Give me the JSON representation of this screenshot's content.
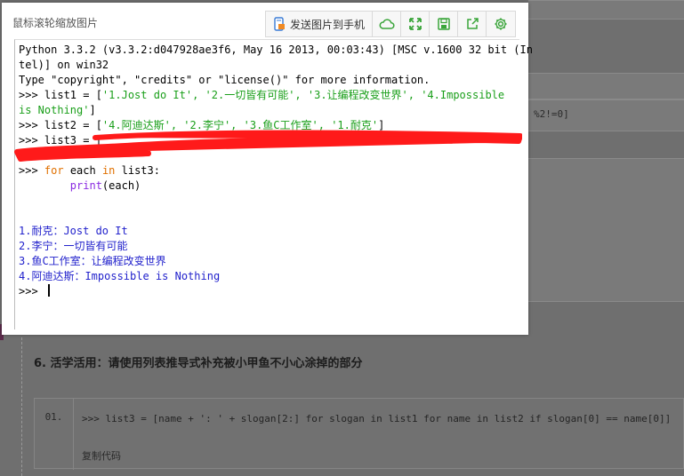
{
  "viewer": {
    "title": "鼠标滚轮缩放图片",
    "send_label": "发送图片到手机"
  },
  "toolbar_icons": [
    "phone-send-icon",
    "cloud-icon",
    "fullscreen-icon",
    "save-icon",
    "share-icon",
    "settings-icon"
  ],
  "colors": {
    "accent": "#3aa53a",
    "string": "#1a9f1a",
    "output": "#2222cc",
    "keyword": "#e07000",
    "builtin": "#8a2be2",
    "scribble": "#ff0000"
  },
  "console": {
    "l1": "Python 3.3.2 (v3.3.2:d047928ae3f6, May 16 2013, 00:03:43) [MSC v.1600 32 bit (In",
    "l2": "tel)] on win32",
    "l3": "Type \"copyright\", \"credits\" or \"license()\" for more information.",
    "l4_prompt": ">>> list1 = [",
    "l4_str": "'1.Jost do It', '2.一切皆有可能', '3.让编程改变世界', '4.Impossible",
    "l5_str": "is Nothing'",
    "l5_end": "]",
    "l6_prompt": ">>> list2 = [",
    "l6_str": "'4.阿迪达斯', '2.李宁', '3.鱼C工作室', '1.耐克'",
    "l6_end": "]",
    "l7": ">>> list3 = [",
    "l9_prompt": ">>> ",
    "l9_for": "for",
    "l9_mid": " each ",
    "l9_in": "in",
    "l9_end": " list3:",
    "l10_indent": "        ",
    "l10_print": "print",
    "l10_end": "(each)",
    "out1": "1.耐克：Jost do It",
    "out2": "2.李宁：一切皆有可能",
    "out3": "3.鱼C工作室：让编程改变世界",
    "out4": "4.阿迪达斯：Impossible is Nothing",
    "last_prompt": ">>> "
  },
  "background": {
    "snippet": "%2!=0]",
    "heading": "6. 活学活用：请使用列表推导式补充被小甲鱼不小心涂掉的部分",
    "line_number": "01.",
    "code_line": ">>> list3 = [name + ': ' + slogan[2:] for slogan in list1 for name in list2 if slogan[0] == name[0]]",
    "copy_label": "复制代码"
  }
}
